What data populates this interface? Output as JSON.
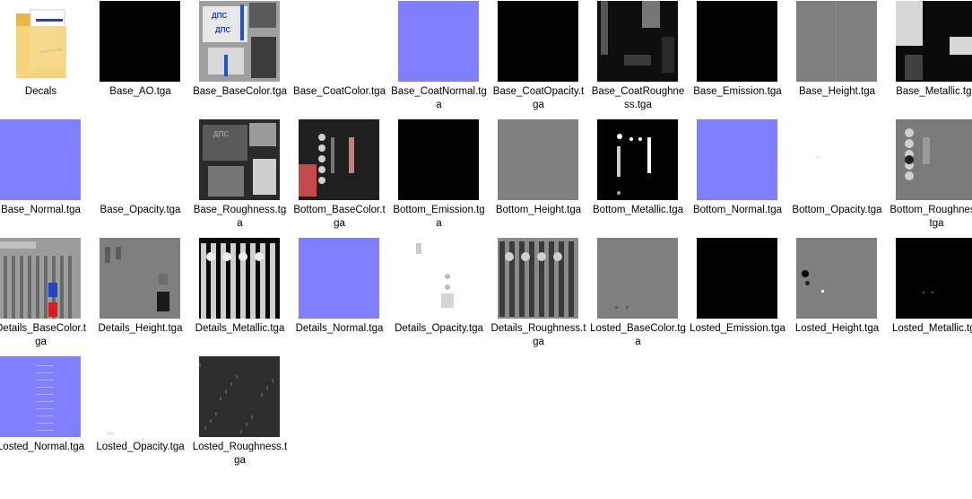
{
  "items": [
    {
      "name": "Decals",
      "kind": "folder",
      "icon": "folder-icon"
    },
    {
      "name": "Base_AO.tga",
      "kind": "tga",
      "swatch": "#000000"
    },
    {
      "name": "Base_BaseColor.tga",
      "kind": "tga",
      "swatch": "#9a9a9a",
      "detail": "ДПС"
    },
    {
      "name": "Base_CoatColor.tga",
      "kind": "tga",
      "swatch": "#ffffff"
    },
    {
      "name": "Base_CoatNormal.tga",
      "kind": "tga",
      "swatch": "#8080fe"
    },
    {
      "name": "Base_CoatOpacity.tga",
      "kind": "tga",
      "swatch": "#000000"
    },
    {
      "name": "Base_CoatRoughness.tga",
      "kind": "tga",
      "swatch": "#1a1a1a"
    },
    {
      "name": "Base_Emission.tga",
      "kind": "tga",
      "swatch": "#000000"
    },
    {
      "name": "Base_Height.tga",
      "kind": "tga",
      "swatch": "#808080"
    },
    {
      "name": "Base_Metallic.tga",
      "kind": "tga",
      "swatch": "#2a2a2a"
    },
    {
      "name": "Base_Normal.tga",
      "kind": "tga",
      "swatch": "#8080fe"
    },
    {
      "name": "Base_Opacity.tga",
      "kind": "tga",
      "swatch": "#ffffff"
    },
    {
      "name": "Base_Roughness.tga",
      "kind": "tga",
      "swatch": "#444444",
      "detail": "ДПС"
    },
    {
      "name": "Bottom_BaseColor.tga",
      "kind": "tga",
      "swatch": "#2a2a2a"
    },
    {
      "name": "Bottom_Emission.tga",
      "kind": "tga",
      "swatch": "#000000"
    },
    {
      "name": "Bottom_Height.tga",
      "kind": "tga",
      "swatch": "#808080"
    },
    {
      "name": "Bottom_Metallic.tga",
      "kind": "tga",
      "swatch": "#000000"
    },
    {
      "name": "Bottom_Normal.tga",
      "kind": "tga",
      "swatch": "#8080fe"
    },
    {
      "name": "Bottom_Opacity.tga",
      "kind": "tga",
      "swatch": "#ffffff"
    },
    {
      "name": "Bottom_Roughness.tga",
      "kind": "tga",
      "swatch": "#777777"
    },
    {
      "name": "Details_BaseColor.tga",
      "kind": "tga",
      "swatch": "#a0a0a0"
    },
    {
      "name": "Details_Height.tga",
      "kind": "tga",
      "swatch": "#808080"
    },
    {
      "name": "Details_Metallic.tga",
      "kind": "tga",
      "swatch": "#1a1a1a"
    },
    {
      "name": "Details_Normal.tga",
      "kind": "tga",
      "swatch": "#8080fe"
    },
    {
      "name": "Details_Opacity.tga",
      "kind": "tga",
      "swatch": "#ffffff"
    },
    {
      "name": "Details_Roughness.tga",
      "kind": "tga",
      "swatch": "#8a8a8a"
    },
    {
      "name": "Losted_BaseColor.tga",
      "kind": "tga",
      "swatch": "#7f7f7f"
    },
    {
      "name": "Losted_Emission.tga",
      "kind": "tga",
      "swatch": "#000000"
    },
    {
      "name": "Losted_Height.tga",
      "kind": "tga",
      "swatch": "#808080"
    },
    {
      "name": "Losted_Metallic.tga",
      "kind": "tga",
      "swatch": "#000000"
    },
    {
      "name": "Losted_Normal.tga",
      "kind": "tga",
      "swatch": "#8080fe"
    },
    {
      "name": "Losted_Opacity.tga",
      "kind": "tga",
      "swatch": "#ffffff"
    },
    {
      "name": "Losted_Roughness.tga",
      "kind": "tga",
      "swatch": "#2d2d2d"
    }
  ]
}
